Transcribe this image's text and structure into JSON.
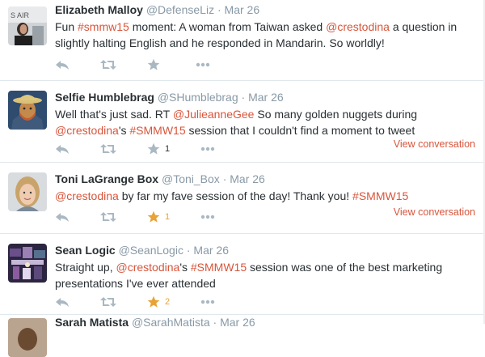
{
  "colors": {
    "link": "#d8553b",
    "muted": "#8899a6",
    "star_active": "#e8a235",
    "divider": "#e1e8ed"
  },
  "tweets": [
    {
      "name": "Elizabeth Malloy",
      "handle": "@DefenseLiz",
      "date": "Mar 26",
      "body": [
        {
          "t": "Fun ",
          "link": false
        },
        {
          "t": "#smmw15",
          "link": true
        },
        {
          "t": " moment: A woman from Taiwan asked ",
          "link": false
        },
        {
          "t": "@crestodina",
          "link": true
        },
        {
          "t": " a question in slightly halting English and he responded in Mandarin. So worldly!",
          "link": false
        }
      ],
      "favorites": "",
      "favorited": false,
      "view_conversation": ""
    },
    {
      "name": "Selfie Humblebrag",
      "handle": "@SHumblebrag",
      "date": "Mar 26",
      "body": [
        {
          "t": "Well that's just sad. RT ",
          "link": false
        },
        {
          "t": "@JulieanneGee",
          "link": true
        },
        {
          "t": " So many golden nuggets during ",
          "link": false
        },
        {
          "t": "@crestodina",
          "link": true
        },
        {
          "t": "'s ",
          "link": false
        },
        {
          "t": "#SMMW15",
          "link": true
        },
        {
          "t": " session that I couldn't find a moment to tweet",
          "link": false
        }
      ],
      "favorites": "1",
      "favorited": false,
      "view_conversation": "View conversation"
    },
    {
      "name": "Toni LaGrange Box",
      "handle": "@Toni_Box",
      "date": "Mar 26",
      "body": [
        {
          "t": "@crestodina",
          "link": true
        },
        {
          "t": " by far my fave session of the day! Thank you! ",
          "link": false
        },
        {
          "t": "#SMMW15",
          "link": true
        }
      ],
      "favorites": "1",
      "favorited": true,
      "view_conversation": "View conversation"
    },
    {
      "name": "Sean Logic",
      "handle": "@SeanLogic",
      "date": "Mar 26",
      "body": [
        {
          "t": "Straight up, ",
          "link": false
        },
        {
          "t": "@crestodina",
          "link": true
        },
        {
          "t": "'s ",
          "link": false
        },
        {
          "t": "#SMMW15",
          "link": true
        },
        {
          "t": " session was one of the best marketing presentations I've ever attended",
          "link": false
        }
      ],
      "favorites": "2",
      "favorited": true,
      "view_conversation": ""
    },
    {
      "name": "Sarah Matista",
      "handle": "@SarahMatista",
      "date": "Mar 26",
      "body": [],
      "favorites": "",
      "favorited": false,
      "view_conversation": ""
    }
  ],
  "avatar_text": "S AIR"
}
